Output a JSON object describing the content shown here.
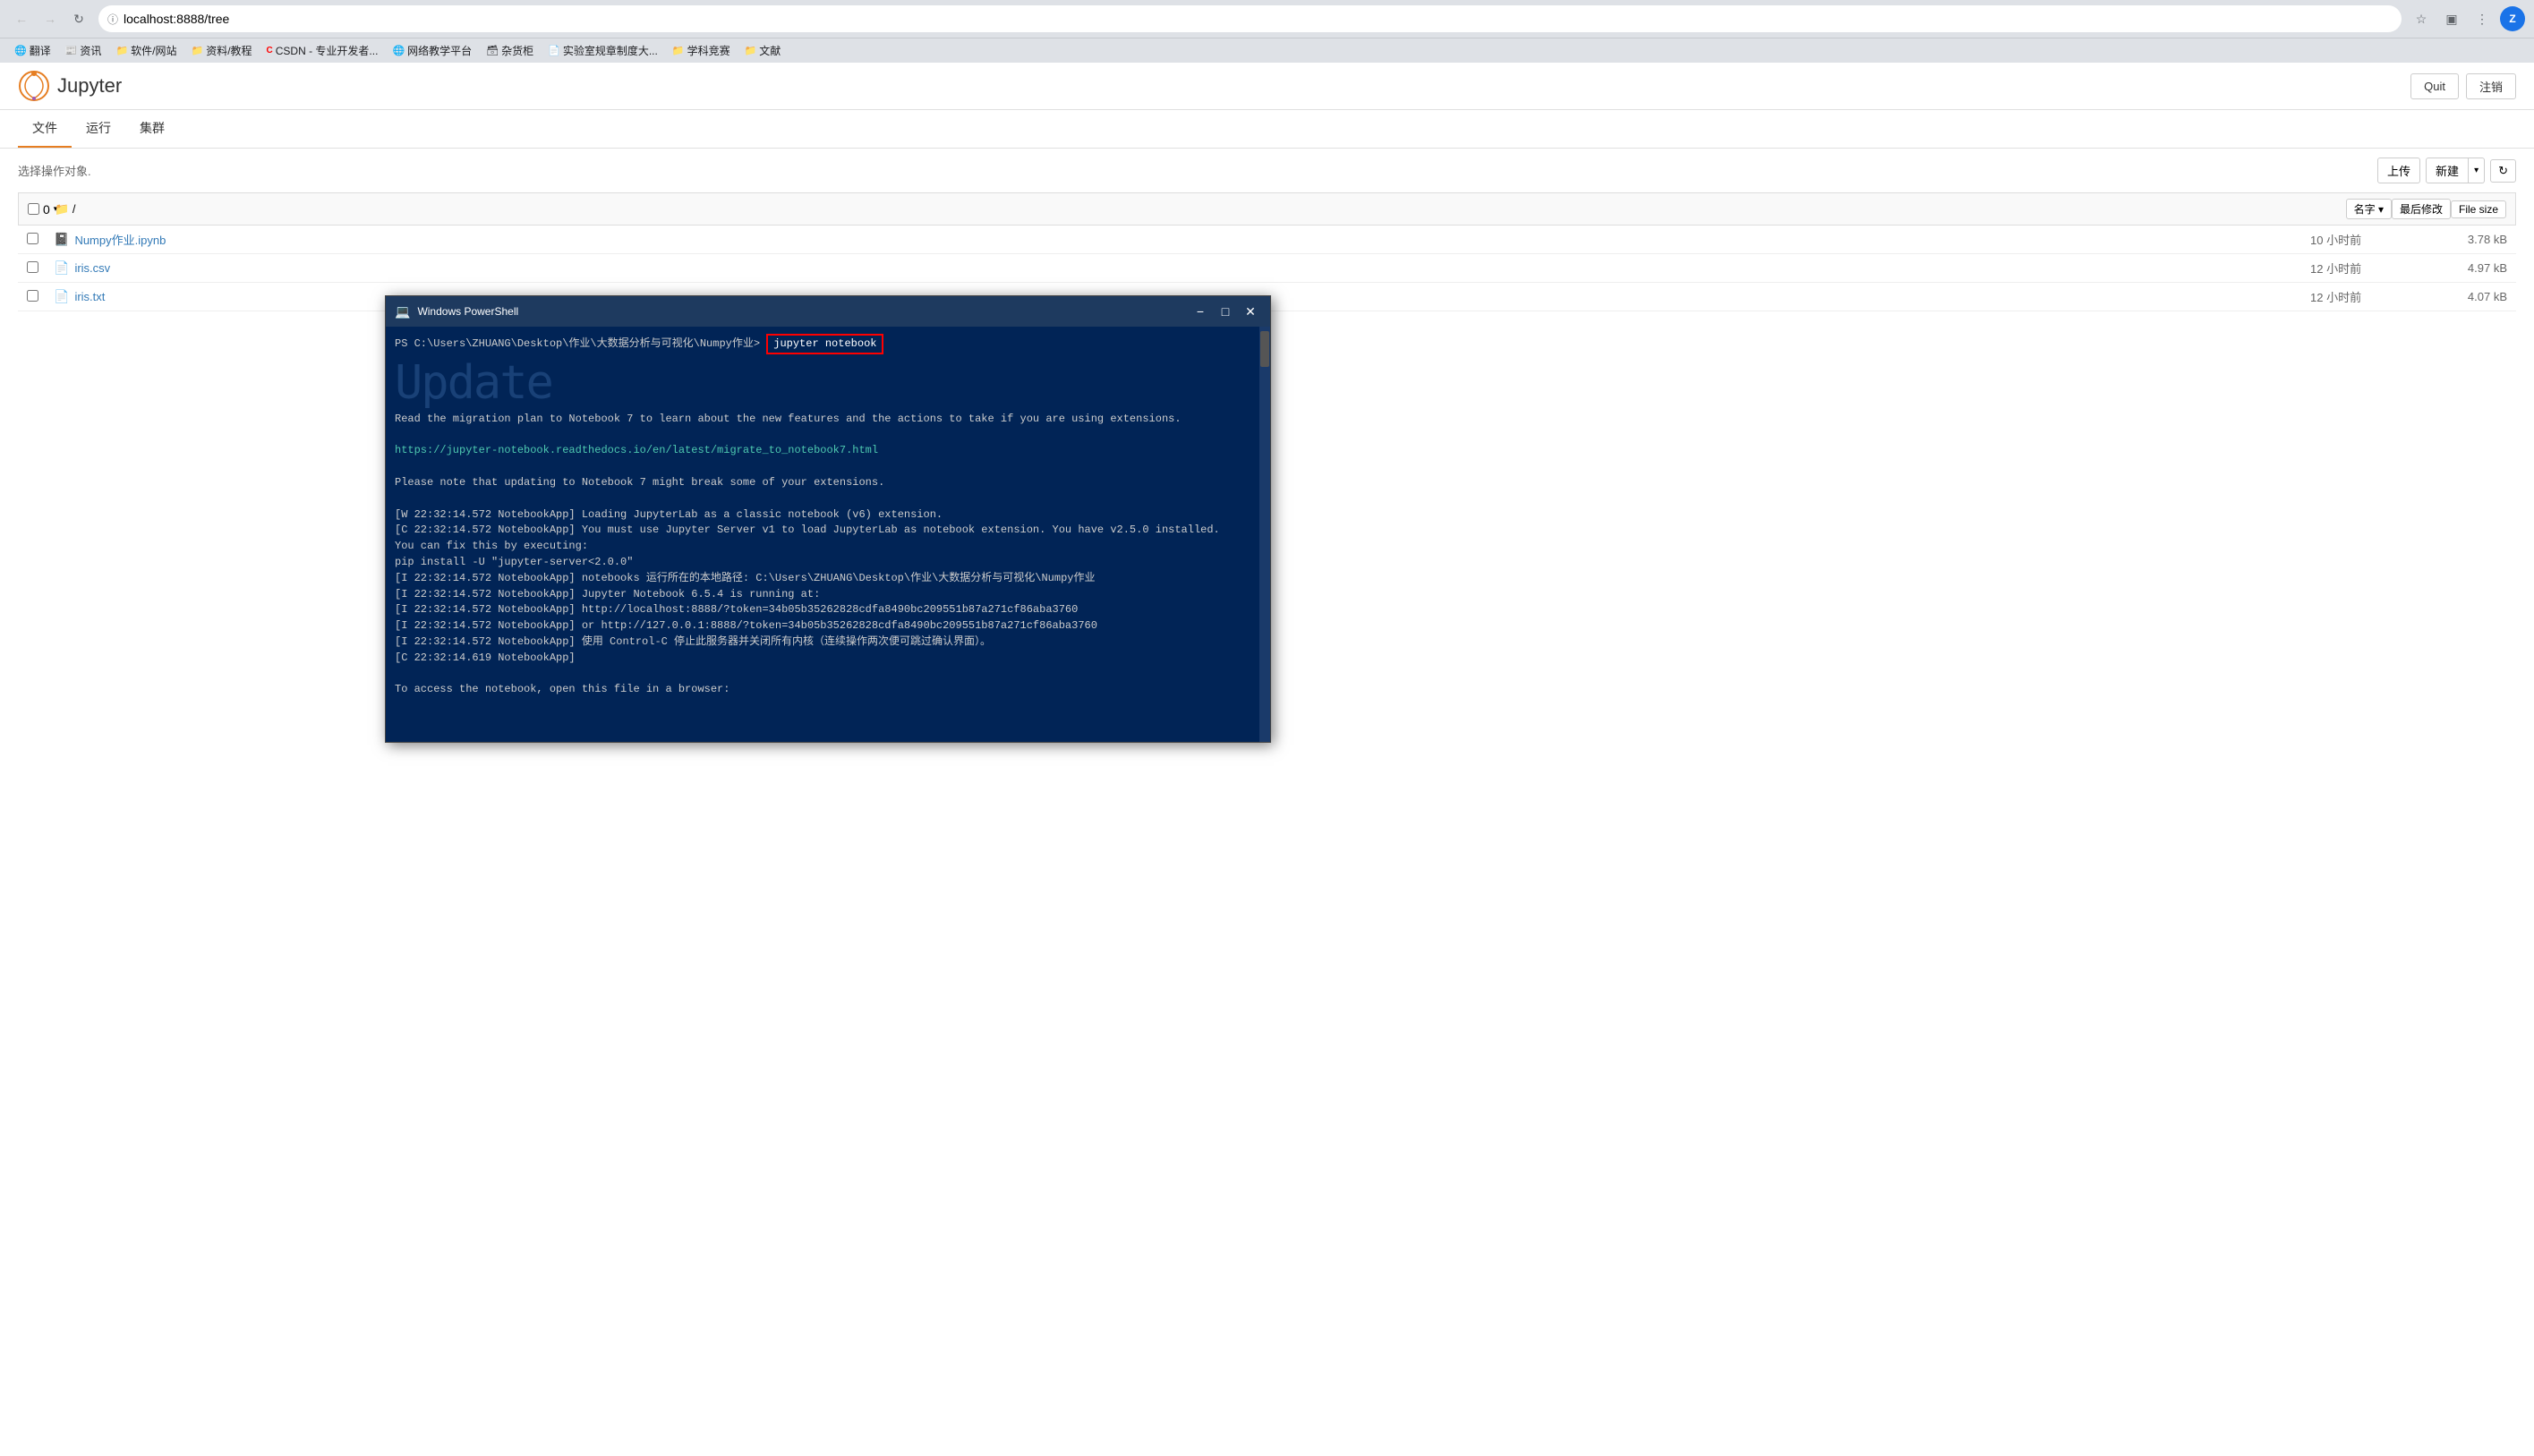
{
  "browser": {
    "url": "localhost:8888/tree",
    "back_disabled": false,
    "forward_disabled": false,
    "bookmarks": [
      {
        "label": "翻译",
        "icon": "🌐"
      },
      {
        "label": "资讯",
        "icon": "📰"
      },
      {
        "label": "软件/网站",
        "icon": "📁"
      },
      {
        "label": "资料/教程",
        "icon": "📁"
      },
      {
        "label": "CSDN - 专业开发者...",
        "icon": "🅲"
      },
      {
        "label": "网络教学平台",
        "icon": "🌐"
      },
      {
        "label": "杂货柜",
        "icon": "🗃"
      },
      {
        "label": "实验室规章制度大...",
        "icon": "📄"
      },
      {
        "label": "学科竞赛",
        "icon": "📁"
      },
      {
        "label": "文献",
        "icon": "📁"
      }
    ]
  },
  "jupyter": {
    "logo_text": "Jupyter",
    "tabs": [
      {
        "label": "文件",
        "active": true
      },
      {
        "label": "运行",
        "active": false
      },
      {
        "label": "集群",
        "active": false
      }
    ],
    "header": {
      "quit_label": "Quit",
      "logout_label": "注销"
    },
    "file_browser": {
      "select_label": "选择操作对象.",
      "upload_label": "上传",
      "new_label": "新建",
      "sort_label": "名字 ▾",
      "modified_label": "最后修改",
      "size_label": "File size",
      "breadcrumb": "/",
      "count": "0",
      "files": [
        {
          "name": "Numpy作业.ipynb",
          "type": "notebook",
          "modified": "10 小时前",
          "size": "3.78 kB"
        },
        {
          "name": "iris.csv",
          "type": "csv",
          "modified": "12 小时前",
          "size": "4.97 kB"
        },
        {
          "name": "iris.txt",
          "type": "txt",
          "modified": "12 小时前",
          "size": "4.07 kB"
        }
      ]
    }
  },
  "powershell": {
    "title": "Windows PowerShell",
    "prompt": "PS C:\\Users\\ZHUANG\\Desktop\\作业\\大数据分析与可视化\\Numpy作业>",
    "command": "jupyter notebook",
    "update_text": "Update",
    "lines": [
      "Read the migration plan to Notebook 7 to learn about the new features and the actions to take if you are using extensions.",
      "",
      "https://jupyter-notebook.readthedocs.io/en/latest/migrate_to_notebook7.html",
      "",
      "Please note that updating to Notebook 7 might break some of your extensions.",
      "",
      "[W 22:32:14.572 NotebookApp] Loading JupyterLab as a classic notebook (v6) extension.",
      "[C 22:32:14.572 NotebookApp] You must use Jupyter Server v1 to load JupyterLab as notebook extension. You have v2.5.0 installed.",
      "    You can fix this by executing:",
      "        pip install -U \"jupyter-server<2.0.0\"",
      "[I 22:32:14.572 NotebookApp] notebooks 运行所在的本地路径: C:\\Users\\ZHUANG\\Desktop\\作业\\大数据分析与可视化\\Numpy作业",
      "[I 22:32:14.572 NotebookApp] Jupyter Notebook 6.5.4 is running at:",
      "[I 22:32:14.572 NotebookApp] http://localhost:8888/?token=34b05b35262828cdfa8490bc209551b87a271cf86aba3760",
      "[I 22:32:14.572 NotebookApp]  or http://127.0.0.1:8888/?token=34b05b35262828cdfa8490bc209551b87a271cf86aba3760",
      "[I 22:32:14.572 NotebookApp] 使用 Control-C 停止此服务器并关闭所有内核（连续操作两次便可跳过确认界面）。",
      "[C 22:32:14.619 NotebookApp]",
      "",
      "    To access the notebook, open this file in a browser:"
    ]
  }
}
